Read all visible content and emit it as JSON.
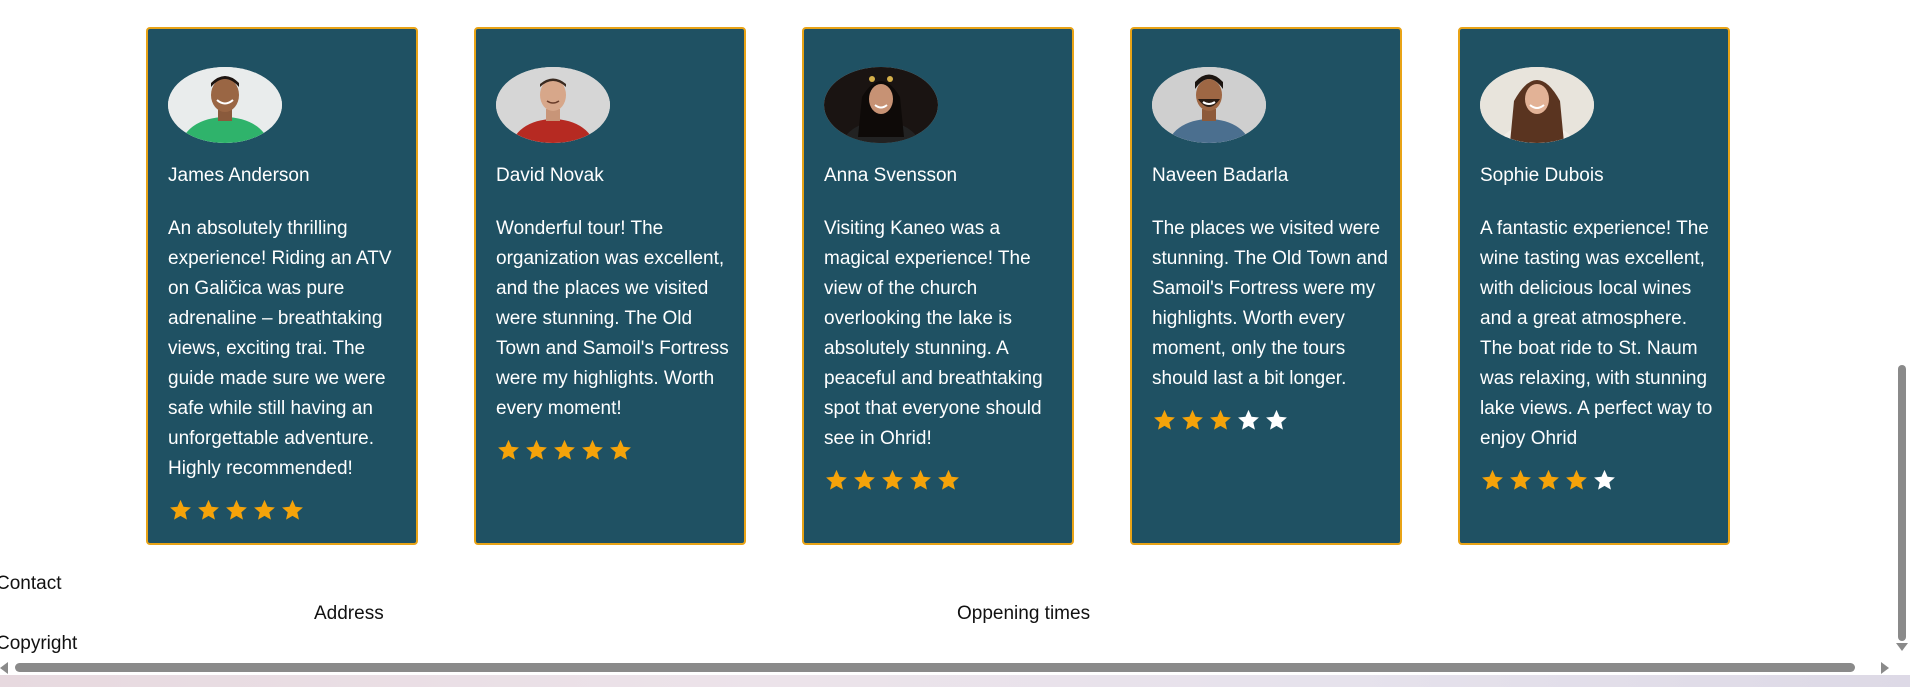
{
  "testimonials": [
    {
      "name": "James Anderson",
      "review": "An absolutely thrilling experience! Riding an ATV on Galičica was pure adrenaline – breathtaking views, exciting trai. The guide made sure we were safe while still having an unforgettable adventure. Highly recommended!",
      "rating": 5
    },
    {
      "name": "David Novak",
      "review": "Wonderful tour! The organization was excellent, and the places we visited were stunning. The Old Town and Samoil's Fortress were my highlights. Worth every moment!",
      "rating": 5
    },
    {
      "name": "Anna Svensson",
      "review": "Visiting Kaneo was a magical experience! The view of the church overlooking the lake is absolutely stunning. A peaceful and breathtaking spot that everyone should see in Ohrid!",
      "rating": 5
    },
    {
      "name": "Naveen Badarla",
      "review": "The places we visited were stunning. The Old Town and Samoil's Fortress were my highlights. Worth every moment, only the tours should last a bit longer.",
      "rating": 3
    },
    {
      "name": "Sophie Dubois",
      "review": "A fantastic experience! The wine tasting was excellent, with delicious local wines and a great atmosphere. The boat ride to St. Naum was relaxing, with stunning lake views. A perfect way to enjoy Ohrid",
      "rating": 4
    }
  ],
  "footer": {
    "contact": "Contact",
    "address": "Address",
    "opening_times": "Oppening times",
    "copyright": "Copyright"
  },
  "colors": {
    "card_bg": "#1f5163",
    "card_border": "#e8a317",
    "star_filled": "#f5a30a",
    "star_empty": "#ffffff"
  },
  "icons": {
    "star": "star-icon",
    "avatar": "person-avatar"
  }
}
